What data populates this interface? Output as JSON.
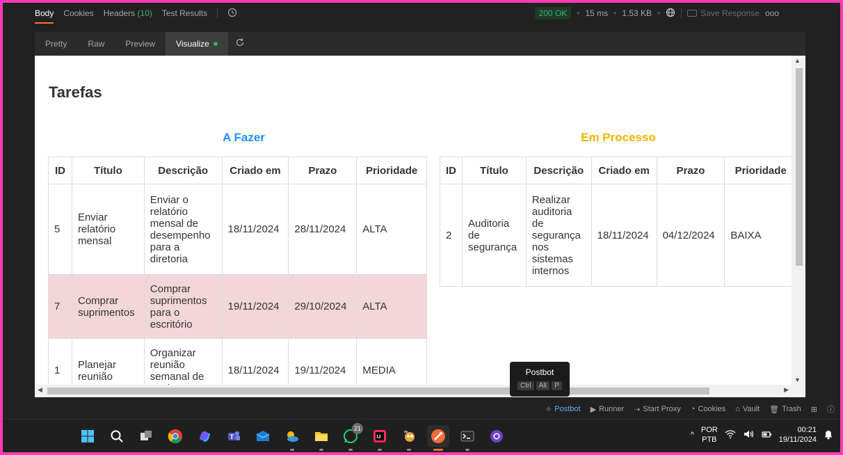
{
  "response_bar": {
    "tabs": [
      {
        "label": "Body"
      },
      {
        "label": "Cookies"
      },
      {
        "label": "Headers",
        "count": "(10)"
      },
      {
        "label": "Test Results"
      }
    ],
    "status": "200 OK",
    "time": "15 ms",
    "size": "1.53 KB",
    "save_response": "Save Response",
    "more": "ooo"
  },
  "view_tabs": [
    "Pretty",
    "Raw",
    "Preview",
    "Visualize"
  ],
  "visualize": {
    "page_title": "Tarefas",
    "todo": {
      "title": "A Fazer",
      "headers": [
        "ID",
        "Título",
        "Descrição",
        "Criado em",
        "Prazo",
        "Prioridade"
      ],
      "rows": [
        {
          "id": "5",
          "titulo": "Enviar relatório mensal",
          "descricao": "Enviar o relatório mensal de desempenho para a diretoria",
          "criado": "18/11/2024",
          "prazo": "28/11/2024",
          "prioridade": "ALTA"
        },
        {
          "id": "7",
          "titulo": "Comprar suprimentos",
          "descricao": "Comprar suprimentos para o escritório",
          "criado": "19/11/2024",
          "prazo": "29/10/2024",
          "prioridade": "ALTA"
        },
        {
          "id": "1",
          "titulo": "Planejar reunião",
          "descricao": "Organizar reunião semanal de equipe",
          "criado": "18/11/2024",
          "prazo": "19/11/2024",
          "prioridade": "MEDIA"
        }
      ]
    },
    "in_process": {
      "title": "Em Processo",
      "headers": [
        "ID",
        "Título",
        "Descrição",
        "Criado em",
        "Prazo",
        "Prioridade"
      ],
      "rows": [
        {
          "id": "2",
          "titulo": "Auditoria de segurança",
          "descricao": "Realizar auditoria de segurança nos sistemas internos",
          "criado": "18/11/2024",
          "prazo": "04/12/2024",
          "prioridade": "BAIXA"
        }
      ]
    }
  },
  "tooltip": {
    "title": "Postbot",
    "keys": [
      "Ctrl",
      "Alt",
      "P"
    ]
  },
  "status_bar": {
    "postbot": "Postbot",
    "runner": "Runner",
    "start_proxy": "Start Proxy",
    "cookies": "Cookies",
    "vault": "Vault",
    "trash": "Trash"
  },
  "taskbar": {
    "whatsapp_badge": "21",
    "lang_top": "POR",
    "lang_bottom": "PTB",
    "time": "00:21",
    "date": "19/11/2024"
  },
  "colors": {
    "frame_border": "#ff3cb4",
    "todo_title": "#1e90ff",
    "proc_title": "#f0b400",
    "highlight_row": "#f3d6d9",
    "status_ok": "#3bb273",
    "accent": "#ff6c37"
  }
}
